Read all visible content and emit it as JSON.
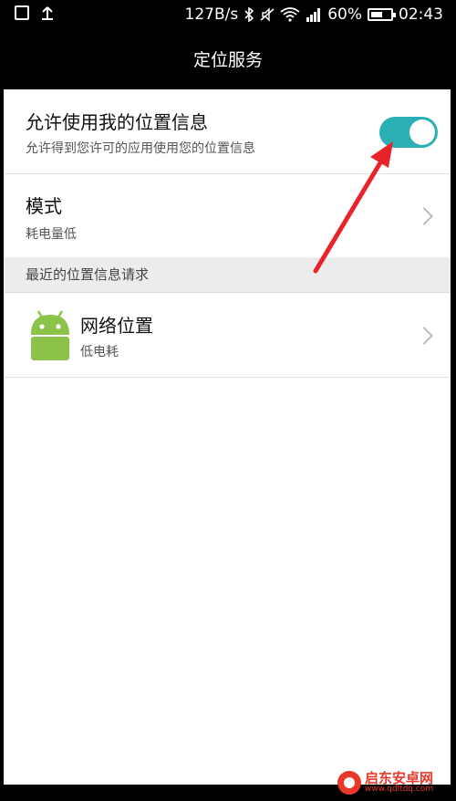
{
  "status_bar": {
    "speed": "127B/s",
    "battery": "60%",
    "battery_level": 0.6,
    "time": "02:43"
  },
  "title": "定位服务",
  "location_toggle": {
    "title": "允许使用我的位置信息",
    "subtitle": "允许得到您许可的应用使用您的位置信息",
    "state": "on",
    "color": "#2ab0b4"
  },
  "mode": {
    "title": "模式",
    "subtitle": "耗电量低"
  },
  "recent_requests": {
    "header": "最近的位置信息请求",
    "items": [
      {
        "icon": "android-icon",
        "title": "网络位置",
        "subtitle": "低电耗"
      }
    ]
  },
  "annotation": {
    "color": "#e8242a"
  },
  "watermark": {
    "brand": "启东安卓网",
    "url": "www.qdltdq.com"
  }
}
